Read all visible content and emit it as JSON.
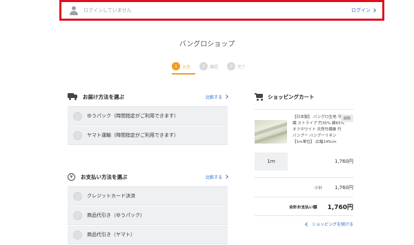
{
  "login": {
    "status": "ログインしていません",
    "link": "ログイン"
  },
  "shop_title": "バングロショップ",
  "steps": [
    {
      "num": "1",
      "label": "入力",
      "active": true
    },
    {
      "num": "2",
      "label": "確認",
      "active": false
    },
    {
      "num": "3",
      "label": "完了",
      "active": false
    }
  ],
  "delivery": {
    "title": "お届け方法を選ぶ",
    "compare": "比較する",
    "options": [
      "ゆうパック（時間指定がご利用できます）",
      "ヤマト運輸（時間指定がご利用できます）"
    ]
  },
  "payment": {
    "title": "お支払い方法を選ぶ",
    "compare": "比較する",
    "options": [
      "クレジットカード決済",
      "商品代引き（ゆうパック）",
      "商品代引き（ヤマト）"
    ]
  },
  "cart": {
    "title": "ショッピングカート",
    "product_name": "【日本製】 バングロ生地 平織 ストライプ 竹35% 綿65% オフホワイト 天然竹繊維 竹 バンブー バンブーリネン 【1m単位】 広幅145cm",
    "delete": "削除",
    "qty": "1ｍ",
    "line_price": "1,760円",
    "subtotal_label": "小計",
    "subtotal": "1,760円",
    "total_label": "合計お支払い額",
    "total": "1,760円",
    "continue": "ショッピングを続ける"
  },
  "colors": {
    "accent": "#f39a1f",
    "link": "#2a6fc7",
    "highlight_border": "#e00e1e"
  }
}
